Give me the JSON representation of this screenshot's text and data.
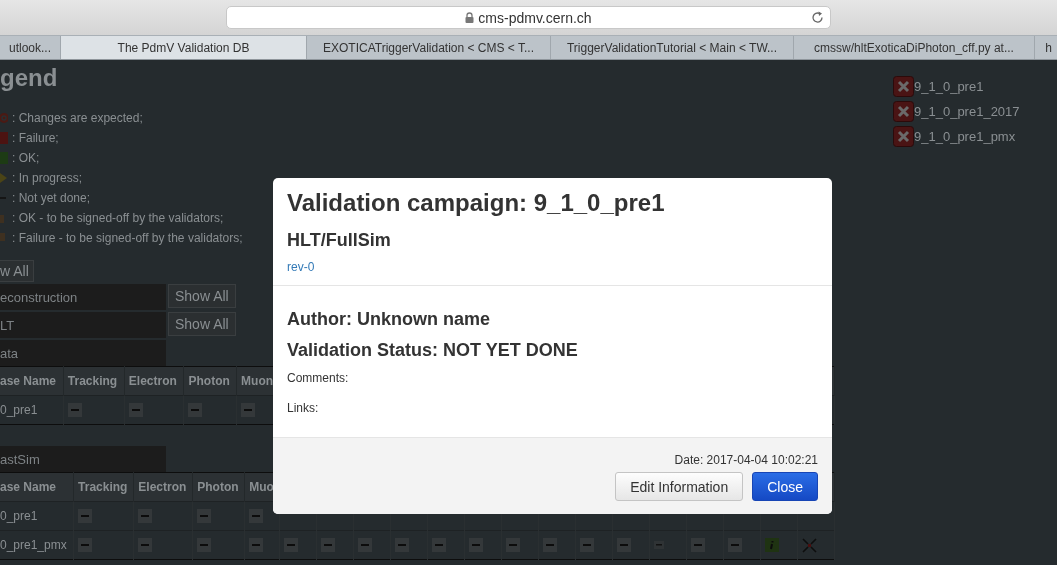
{
  "browser": {
    "address": "cms-pdmv.cern.ch",
    "tabs": [
      {
        "label": "utlook...",
        "selected": false
      },
      {
        "label": "The PdmV Validation DB",
        "selected": true
      },
      {
        "label": "EXOTICATriggerValidation < CMS < T...",
        "selected": false
      },
      {
        "label": "TriggerValidationTutorial < Main < TW...",
        "selected": false
      },
      {
        "label": "cmssw/hltExoticaDiPhoton_cff.py at...",
        "selected": false
      },
      {
        "label": "h",
        "selected": false
      }
    ]
  },
  "legend": {
    "title": "gend",
    "items": [
      {
        "kind": "changes",
        "label": ": Changes are expected;"
      },
      {
        "kind": "failure",
        "label": ": Failure;"
      },
      {
        "kind": "ok",
        "label": ": OK;"
      },
      {
        "kind": "progress",
        "label": ": In progress;"
      },
      {
        "kind": "not_done",
        "label": ": Not yet done;"
      },
      {
        "kind": "ok_signoff",
        "label": ": OK - to be signed-off by the validators;"
      },
      {
        "kind": "fail_signoff",
        "label": ": Failure - to be signed-off by the validators;"
      }
    ]
  },
  "show_all_button": "w All",
  "categories": [
    {
      "label": "econstruction",
      "button": "Show All"
    },
    {
      "label": "LT",
      "button": "Show All"
    }
  ],
  "sections": [
    {
      "label": "ata",
      "columns": [
        "ase Name",
        "Tracking",
        "Electron",
        "Photon",
        "Muon"
      ],
      "rows": [
        {
          "name": "0_pre1",
          "cells": [
            {
              "kind": "dash"
            },
            {
              "kind": "dash"
            },
            {
              "kind": "dash"
            },
            {
              "kind": "dash"
            }
          ]
        }
      ]
    },
    {
      "label": "astSim",
      "columns": [
        "ase Name",
        "Tracking",
        "Electron",
        "Photon",
        "Muo"
      ],
      "rows": [
        {
          "name": "0_pre1",
          "cells": [
            {
              "kind": "dash"
            },
            {
              "kind": "dash"
            },
            {
              "kind": "dash"
            },
            {
              "kind": "dash"
            }
          ]
        },
        {
          "name": "0_pre1_pmx",
          "cells": [
            {
              "kind": "dash"
            },
            {
              "kind": "dash"
            },
            {
              "kind": "dash"
            },
            {
              "kind": "dash"
            },
            {
              "kind": "dash"
            },
            {
              "kind": "dash"
            },
            {
              "kind": "dash"
            },
            {
              "kind": "dash"
            },
            {
              "kind": "dash"
            },
            {
              "kind": "dash"
            },
            {
              "kind": "dash"
            },
            {
              "kind": "dash"
            },
            {
              "kind": "dash"
            },
            {
              "kind": "dash"
            },
            {
              "kind": "small_dash"
            },
            {
              "kind": "dash"
            },
            {
              "kind": "dash"
            },
            {
              "kind": "info"
            },
            {
              "kind": "cross"
            }
          ]
        }
      ]
    }
  ],
  "releases": [
    "9_1_0_pre1",
    "9_1_0_pre1_2017",
    "9_1_0_pre1_pmx"
  ],
  "modal": {
    "title": "Validation campaign: 9_1_0_pre1",
    "subtitle": "HLT/FullSim",
    "link": "rev-0",
    "author": "Author: Unknown name",
    "status": "Validation Status: NOT YET DONE",
    "comments_label": "Comments:",
    "links_label": "Links:",
    "date": "Date: 2017-04-04 10:02:21",
    "buttons": [
      {
        "kind": "default",
        "label": "Edit Information"
      },
      {
        "kind": "primary",
        "label": "Close"
      }
    ]
  }
}
